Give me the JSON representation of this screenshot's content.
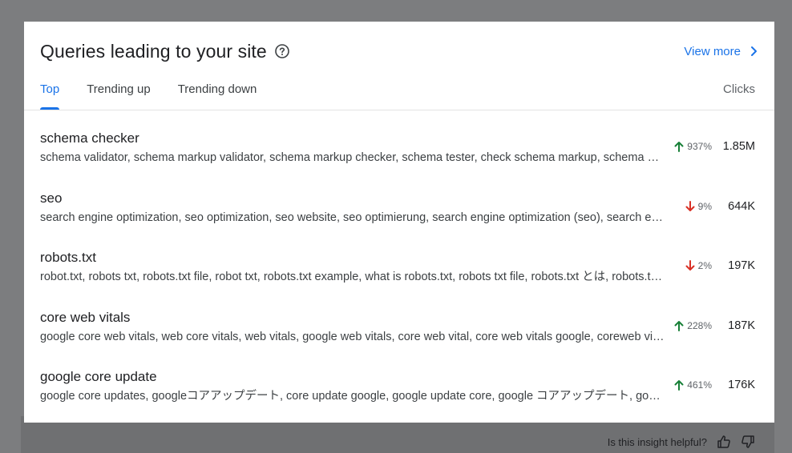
{
  "card": {
    "title": "Queries leading to your site",
    "view_more": "View more"
  },
  "tabs": [
    {
      "label": "Top",
      "active": true
    },
    {
      "label": "Trending up",
      "active": false
    },
    {
      "label": "Trending down",
      "active": false
    }
  ],
  "column_header": "Clicks",
  "rows": [
    {
      "query": "schema checker",
      "related": "schema validator, schema markup validator, schema markup checker, schema tester, check schema markup, schema markup test, structured data checker",
      "change": "937%",
      "direction": "up",
      "clicks": "1.85M"
    },
    {
      "query": "seo",
      "related": "search engine optimization, seo optimization, seo website, seo optimierung, search engine optimization (seo), search engine optimisation",
      "change": "9%",
      "direction": "down",
      "clicks": "644K"
    },
    {
      "query": "robots.txt",
      "related": "robot.txt, robots txt, robots.txt file, robot txt, robots.txt example, what is robots.txt, robots txt file, robots.txt とは, robots.txt generator",
      "change": "2%",
      "direction": "down",
      "clicks": "197K"
    },
    {
      "query": "core web vitals",
      "related": "google core web vitals, web core vitals, web vitals, google web vitals, core web vital, core web vitals google, coreweb vitals",
      "change": "228%",
      "direction": "up",
      "clicks": "187K"
    },
    {
      "query": "google core update",
      "related": "google core updates, googleコアアップデート, core update google, google update core, google コアアップデート, google core algorithm update",
      "change": "461%",
      "direction": "up",
      "clicks": "176K"
    }
  ],
  "footer": {
    "prompt": "Is this insight helpful?"
  },
  "colors": {
    "accent": "#1a73e8",
    "up": "#188038",
    "down": "#d93025"
  },
  "icons": {
    "help": "help-circle-icon",
    "chevron": "chevron-right-icon",
    "thumbs_up": "thumbs-up-icon",
    "thumbs_down": "thumbs-down-icon"
  }
}
